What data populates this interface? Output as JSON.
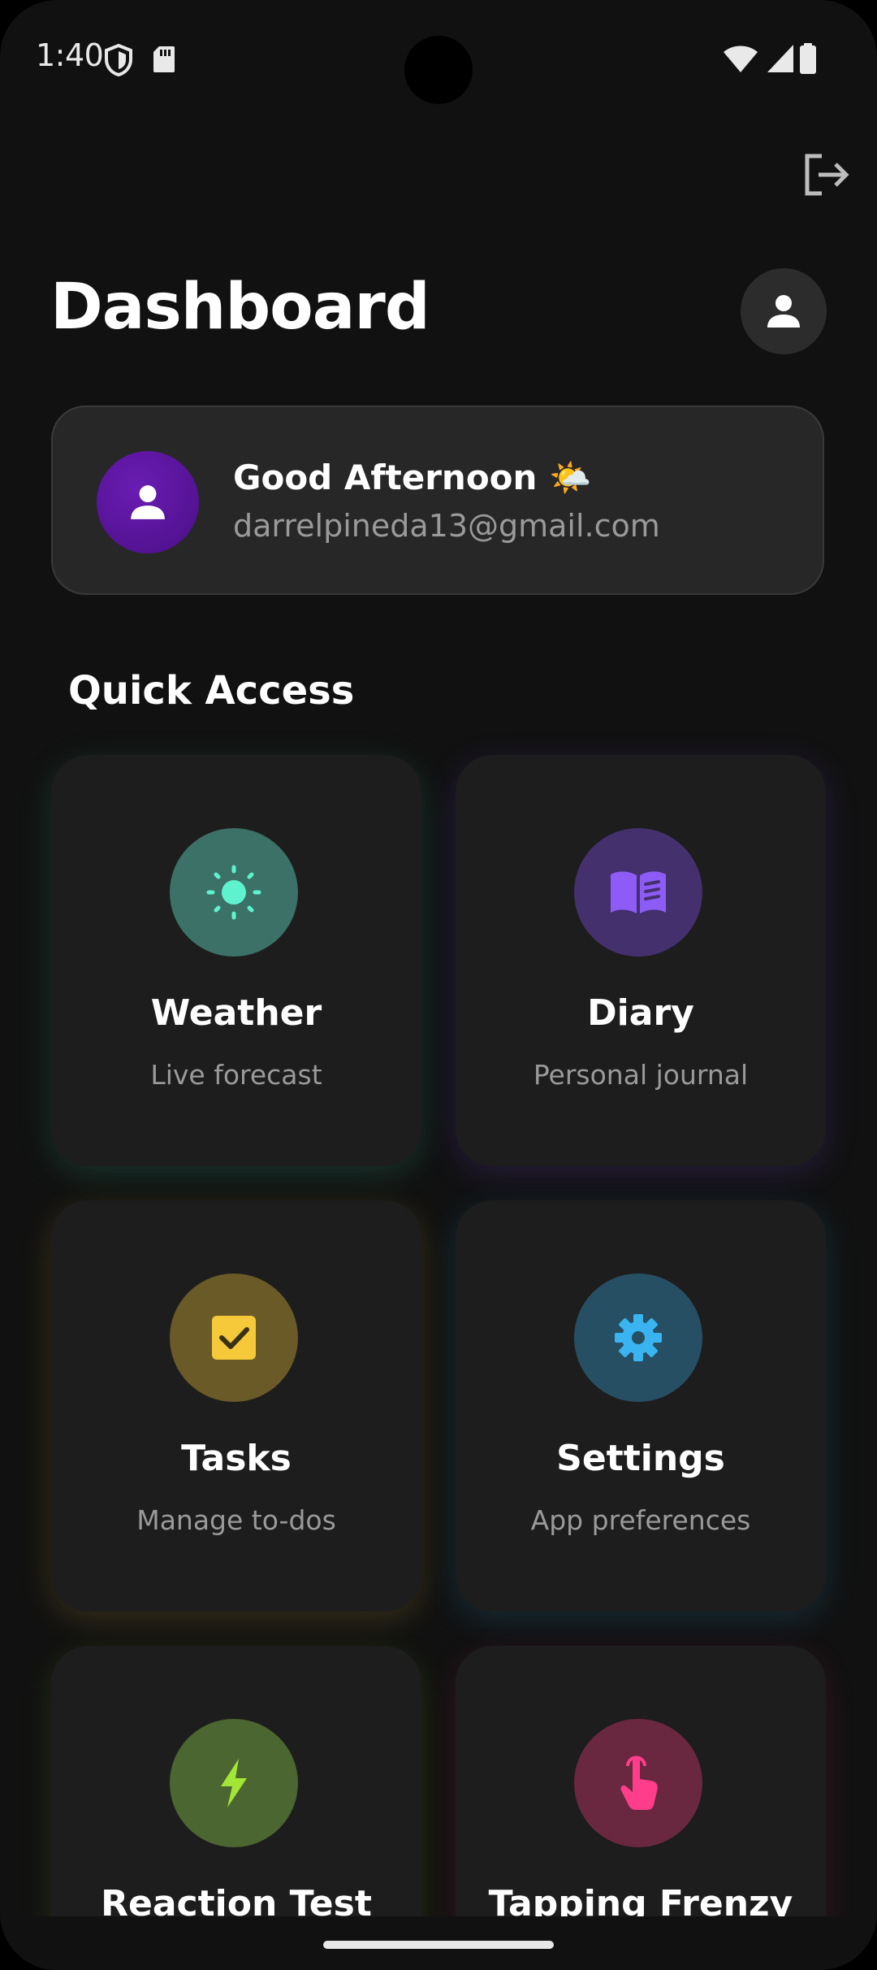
{
  "status_bar": {
    "time": "1:40",
    "left_icons": [
      "shield-icon",
      "sd-card-icon"
    ],
    "right_icons": [
      "wifi-icon",
      "signal-icon",
      "battery-icon"
    ]
  },
  "header": {
    "title": "Dashboard",
    "logout_icon": "logout-icon",
    "profile_icon": "person-icon"
  },
  "greeting": {
    "text": "Good Afternoon 🌤️",
    "email": "darrelpineda13@gmail.com",
    "avatar_icon": "person-icon",
    "avatar_color": "#5a139c"
  },
  "quick_access": {
    "title": "Quick Access",
    "tiles": [
      {
        "title": "Weather",
        "subtitle": "Live forecast",
        "icon": "sun-icon",
        "accent": "#5ff2cf",
        "circle": "#3b7166"
      },
      {
        "title": "Diary",
        "subtitle": "Personal journal",
        "icon": "book-icon",
        "accent": "#8d5cf6",
        "circle": "#45306e"
      },
      {
        "title": "Tasks",
        "subtitle": "Manage to-dos",
        "icon": "checkbox-icon",
        "accent": "#f5c93a",
        "circle": "#6a5a28"
      },
      {
        "title": "Settings",
        "subtitle": "App preferences",
        "icon": "gear-icon",
        "accent": "#39b4f0",
        "circle": "#274f63"
      },
      {
        "title": "Reaction Test",
        "subtitle": "",
        "icon": "bolt-icon",
        "accent": "#a3e635",
        "circle": "#4b6630"
      },
      {
        "title": "Tapping Frenzy",
        "subtitle": "",
        "icon": "tap-icon",
        "accent": "#ff3d8a",
        "circle": "#6a2840"
      }
    ]
  }
}
